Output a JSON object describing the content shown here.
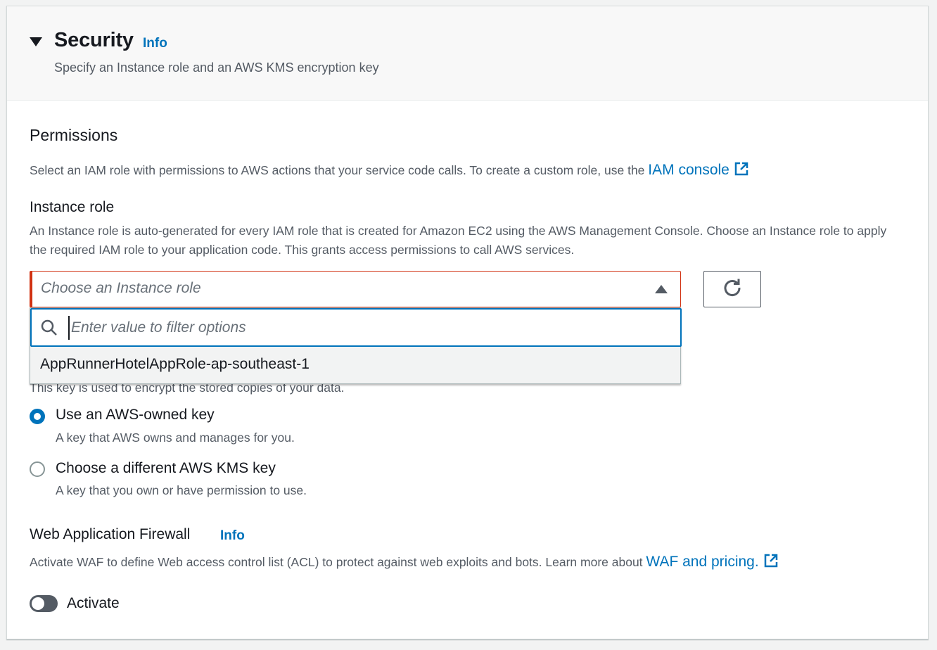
{
  "header": {
    "title": "Security",
    "info": "Info",
    "description": "Specify an Instance role and an AWS KMS encryption key"
  },
  "permissions": {
    "title": "Permissions",
    "description": "Select an IAM role with permissions to AWS actions that your service code calls. To create a custom role, use the",
    "link": "IAM console"
  },
  "instance_role": {
    "label": "Instance role",
    "description": "An Instance role is auto-generated for every IAM role that is created for Amazon EC2 using the AWS Management Console. Choose an Instance role to apply the required IAM role to your application code. This grants access permissions to call AWS services.",
    "placeholder": "Choose an Instance role",
    "filter_placeholder": "Enter value to filter options",
    "options": [
      "AppRunnerHotelAppRole-ap-southeast-1"
    ]
  },
  "kms": {
    "description": "This key is used to encrypt the stored copies of your data.",
    "options": [
      {
        "label": "Use an AWS-owned key",
        "description": "A key that AWS owns and manages for you.",
        "checked": true
      },
      {
        "label": "Choose a different AWS KMS key",
        "description": "A key that you own or have permission to use.",
        "checked": false
      }
    ]
  },
  "waf": {
    "title": "Web Application Firewall",
    "info": "Info",
    "description": "Activate WAF to define Web access control list (ACL) to protect against web exploits and bots. Learn more about",
    "link": "WAF and pricing.",
    "toggle_label": "Activate",
    "active": false
  },
  "colors": {
    "accent": "#0073bb",
    "error": "#d13212",
    "text": "#16191f",
    "secondary_text": "#545b64"
  },
  "icons": {
    "expand": "caret-down-icon",
    "external": "external-link-icon",
    "dropdown": "caret-up-icon",
    "refresh": "refresh-icon",
    "search": "search-icon"
  }
}
